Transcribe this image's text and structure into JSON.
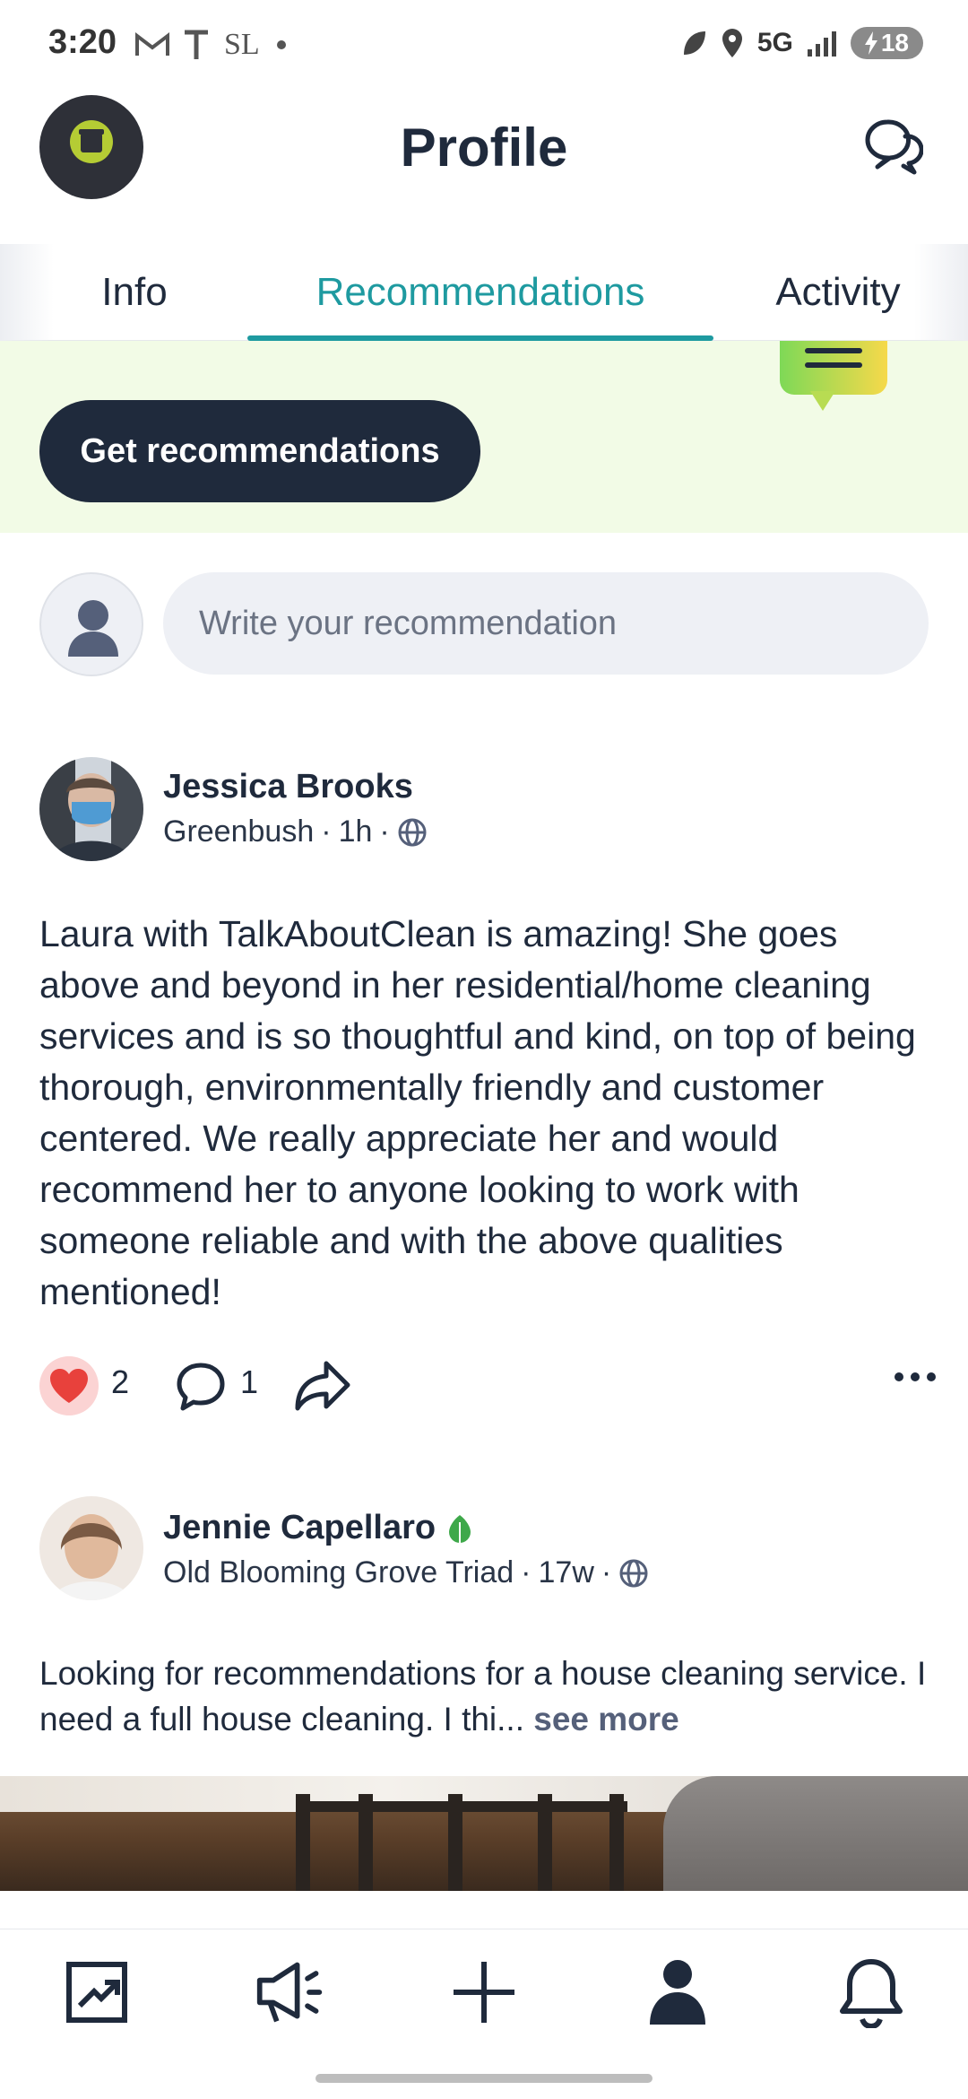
{
  "status_bar": {
    "time": "3:20",
    "left_icons": [
      "gmail-icon",
      "t-icon",
      "sl-icon",
      "dot-icon"
    ],
    "network": "5G",
    "battery": "18"
  },
  "header": {
    "title": "Profile"
  },
  "tabs": [
    {
      "label": "Info",
      "active": false
    },
    {
      "label": "Recommendations",
      "active": true
    },
    {
      "label": "Activity",
      "active": false
    }
  ],
  "banner": {
    "button_label": "Get recommendations"
  },
  "composer": {
    "placeholder": "Write your recommendation"
  },
  "posts": [
    {
      "author": "Jessica Brooks",
      "neighborhood": "Greenbush",
      "time": "1h",
      "body": "Laura with TalkAboutClean is amazing! She goes above and beyond in her residential/home cleaning services and is so thoughtful and kind, on top of being thorough, environmentally friendly and customer centered. We really appreciate her and would recommend her to anyone looking to work with someone reliable and with the above qualities mentioned!",
      "reactions": "2",
      "comments": "1"
    },
    {
      "author": "Jennie Capellaro",
      "neighborhood": "Old Blooming Grove Triad",
      "time": "17w",
      "body": "Looking for recommendations for a house cleaning service. I need a full house cleaning. I thi...",
      "see_more": "see more"
    }
  ],
  "colors": {
    "accent": "#1e9aa0",
    "dark": "#1f2a3c",
    "banner_bg": "#f2fbe6",
    "heart": "#e8413c"
  }
}
